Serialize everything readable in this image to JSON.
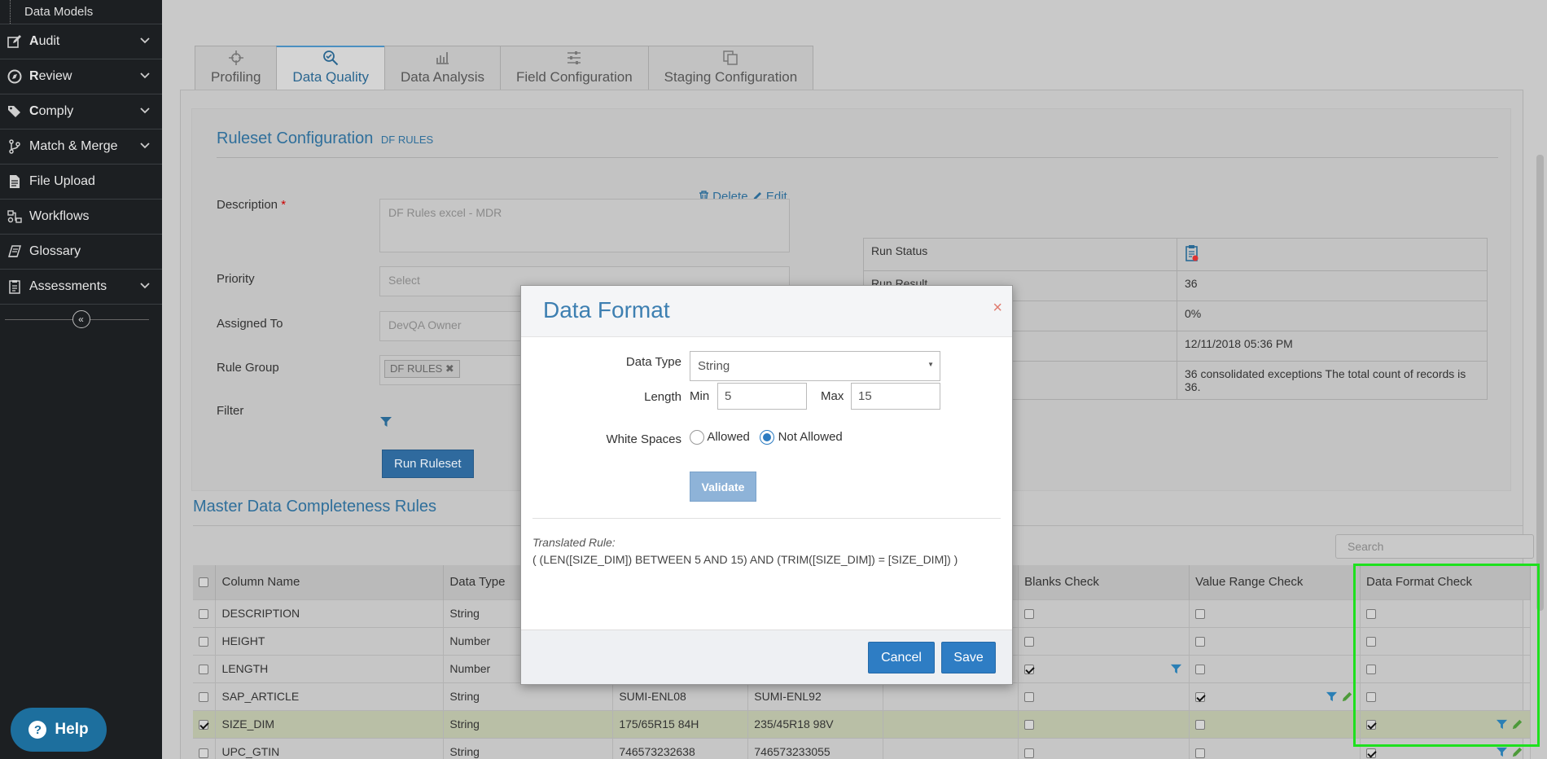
{
  "sidebar": {
    "top_item": "Data Models",
    "items": [
      {
        "label_first": "A",
        "label_rest": "udit",
        "icon": "edit-icon",
        "has_chevron": true
      },
      {
        "label_first": "R",
        "label_rest": "eview",
        "icon": "compass-icon",
        "has_chevron": true
      },
      {
        "label_first": "C",
        "label_rest": "omply",
        "icon": "tags-icon",
        "has_chevron": true
      },
      {
        "label_first": "",
        "label_rest": "Match & Merge",
        "icon": "branch-icon",
        "has_chevron": true
      },
      {
        "label_first": "",
        "label_rest": "File Upload",
        "icon": "file-icon",
        "has_chevron": false
      },
      {
        "label_first": "",
        "label_rest": "Workflows",
        "icon": "workflow-icon",
        "has_chevron": false
      },
      {
        "label_first": "",
        "label_rest": "Glossary",
        "icon": "book-icon",
        "has_chevron": false
      },
      {
        "label_first": "",
        "label_rest": "Assessments",
        "icon": "clipboard-icon",
        "has_chevron": true
      }
    ],
    "collapse_glyph": "«",
    "help_label": "Help",
    "help_glyph": "?"
  },
  "tabs": [
    {
      "label": "Profiling",
      "icon": "crosshair-icon",
      "active": false
    },
    {
      "label": "Data Quality",
      "icon": "search-check-icon",
      "active": true
    },
    {
      "label": "Data Analysis",
      "icon": "analysis-icon",
      "active": false
    },
    {
      "label": "Field Configuration",
      "icon": "sliders-icon",
      "active": false
    },
    {
      "label": "Staging Configuration",
      "icon": "copy-icon",
      "active": false
    }
  ],
  "ruleset": {
    "title": "Ruleset Configuration",
    "subtitle": "DF RULES",
    "delete_label": "Delete",
    "edit_label": "Edit",
    "description_label": "Description",
    "description_required": "*",
    "description_value": "DF Rules excel - MDR",
    "priority_label": "Priority",
    "priority_value": "Select",
    "assigned_label": "Assigned To",
    "assigned_value": "DevQA Owner",
    "rulegroup_label": "Rule Group",
    "rulegroup_chip": "DF RULES",
    "rulegroup_chip_remove": "✖",
    "filter_label": "Filter",
    "run_button": "Run Ruleset",
    "run_status": [
      {
        "key": "Run Status",
        "value": ""
      },
      {
        "key": "Run Result",
        "value": "36"
      },
      {
        "key": "",
        "value": "0%"
      },
      {
        "key": "",
        "value": "12/11/2018 05:36 PM"
      },
      {
        "key": "",
        "value": "36 consolidated exceptions The total count of records is 36."
      }
    ]
  },
  "completeness": {
    "title": "Master Data Completeness Rules",
    "search_placeholder": "Search",
    "headers": [
      "Column Name",
      "Data Type",
      "",
      "",
      "",
      "Blanks Check",
      "Value Range Check",
      "Data Format Check"
    ],
    "rows": [
      {
        "name": "DESCRIPTION",
        "type": "String",
        "min": "",
        "max": "",
        "blank": false,
        "range": false,
        "format": false,
        "selected": false,
        "blank_tools": false,
        "range_tools": false,
        "format_tools": false,
        "highlight": false
      },
      {
        "name": "HEIGHT",
        "type": "Number",
        "min": "",
        "max": "",
        "blank": false,
        "range": false,
        "format": false,
        "selected": false,
        "blank_tools": false,
        "range_tools": false,
        "format_tools": false,
        "highlight": false
      },
      {
        "name": "LENGTH",
        "type": "Number",
        "min": "",
        "max": "",
        "blank": true,
        "range": false,
        "format": false,
        "selected": false,
        "blank_tools": true,
        "range_tools": false,
        "format_tools": false,
        "highlight": false
      },
      {
        "name": "SAP_ARTICLE",
        "type": "String",
        "min": "SUMI-ENL08",
        "max": "SUMI-ENL92",
        "blank": false,
        "range": true,
        "format": false,
        "selected": false,
        "blank_tools": false,
        "range_tools": true,
        "format_tools": false,
        "highlight": false
      },
      {
        "name": "SIZE_DIM",
        "type": "String",
        "min": "175/65R15 84H",
        "max": "235/45R18 98V",
        "blank": false,
        "range": false,
        "format": true,
        "selected": true,
        "blank_tools": false,
        "range_tools": false,
        "format_tools": true,
        "highlight": true
      },
      {
        "name": "UPC_GTIN",
        "type": "String",
        "min": "746573232638",
        "max": "746573233055",
        "blank": false,
        "range": false,
        "format": true,
        "selected": false,
        "blank_tools": false,
        "range_tools": false,
        "format_tools": true,
        "highlight": false
      }
    ]
  },
  "modal": {
    "title": "Data Format",
    "close_glyph": "×",
    "data_type_label": "Data Type",
    "data_type_value": "String",
    "length_label": "Length",
    "min_label": "Min",
    "min_value": "5",
    "max_label": "Max",
    "max_value": "15",
    "white_spaces_label": "White Spaces",
    "allowed_label": "Allowed",
    "not_allowed_label": "Not Allowed",
    "white_spaces_selected": "Not Allowed",
    "validate_label": "Validate",
    "translated_label": "Translated Rule:",
    "translated_text": "( (LEN([SIZE_DIM]) BETWEEN 5 AND 15) AND (TRIM([SIZE_DIM]) = [SIZE_DIM]) )",
    "cancel_label": "Cancel",
    "save_label": "Save"
  },
  "colors": {
    "accent": "#2e7dc4",
    "highlight_box": "#1ee01e",
    "sidebar_bg": "#1c1f22",
    "title_blue": "#3d7fb1"
  }
}
